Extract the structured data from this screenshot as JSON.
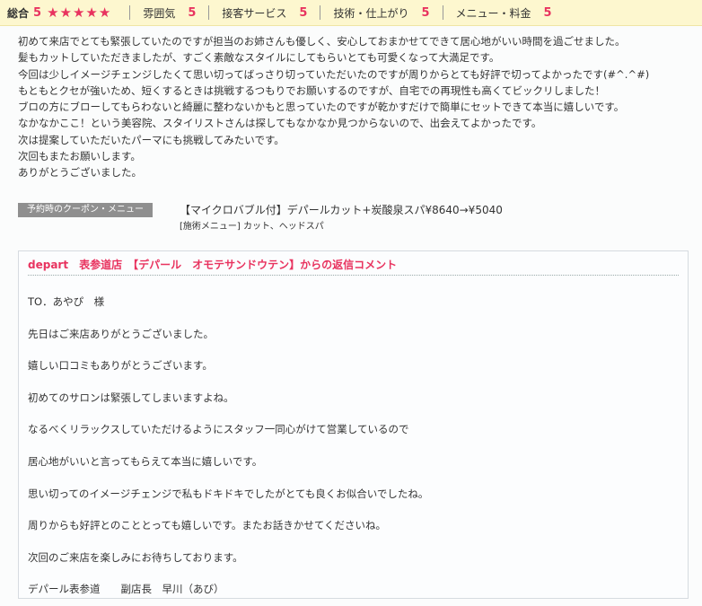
{
  "ratings": {
    "overall": {
      "label": "総合",
      "score": "5",
      "stars": "★★★★★"
    },
    "categories": [
      {
        "label": "雰囲気",
        "score": "5"
      },
      {
        "label": "接客サービス",
        "score": "5"
      },
      {
        "label": "技術・仕上がり",
        "score": "5"
      },
      {
        "label": "メニュー・料金",
        "score": "5"
      }
    ]
  },
  "review": {
    "lines": [
      "初めて来店でとても緊張していたのですが担当のお姉さんも優しく、安心しておまかせてできて居心地がいい時間を過ごせました。",
      "髪もカットしていただきましたが、すごく素敵なスタイルにしてもらいとても可愛くなって大満足です。",
      "今回は少しイメージチェンジしたくて思い切ってばっさり切っていただいたのですが周りからとても好評で切ってよかったです(#^.^#)",
      "もともとクセが強いため、短くするときは挑戦するつもりでお願いするのですが、自宅での再現性も高くてビックリしました！",
      "ブロの方にブローしてもらわないと綺麗に整わないかもと思っていたのですが乾かすだけで簡単にセットできて本当に嬉しいです。",
      "なかなかここ！という美容院、スタイリストさんは探してもなかなか見つからないので、出会えてよかったです。",
      "次は提案していただいたパーマにも挑戦してみたいです。",
      "次回もまたお願いします。",
      "ありがとうございました。"
    ]
  },
  "coupon": {
    "label": "予約時のクーポン・メニュー",
    "title": "【マイクロバブル付】デパールカット+炭酸泉スパ¥8640→¥5040",
    "sub": "[施術メニュー] カット、ヘッドスパ"
  },
  "reply": {
    "title": "depart　表参道店　【デパール　オモテサンドウテン】からの返信コメント",
    "lines": [
      "TO．あやぴ　様",
      "先日はご来店ありがとうございました。",
      "嬉しい口コミもありがとうございます。",
      "初めてのサロンは緊張してしまいますよね。",
      "なるべくリラックスしていただけるようにスタッフ一同心がけて営業しているので",
      "居心地がいいと言ってもらえて本当に嬉しいです。",
      "思い切ってのイメージチェンジで私もドキドキでしたがとても良くお似合いでしたね。",
      "周りからも好評とのこととっても嬉しいです。またお話きかせてくださいね。",
      "次回のご来店を楽しみにお待ちしております。",
      "デパール表参道　　副店長　早川（あび）"
    ]
  },
  "colors": {
    "accent": "#e8335f",
    "ratingsBg": "#fdf7cf",
    "label": "#8f8f8f"
  }
}
